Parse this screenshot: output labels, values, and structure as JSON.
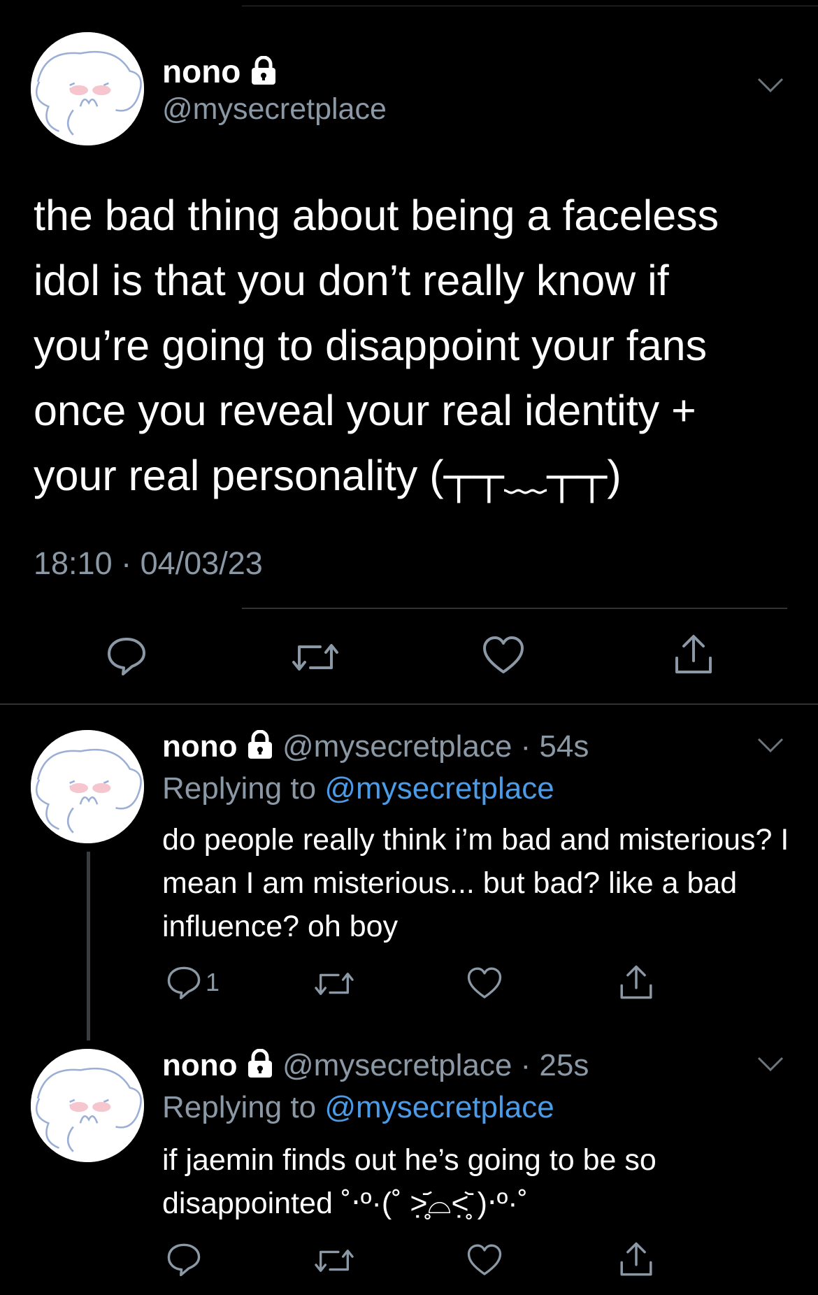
{
  "main_tweet": {
    "display_name": "nono",
    "handle": "@mysecretplace",
    "text": "the bad thing about being a faceless idol is that you don’t really know if you’re going to disappoint your fans once you reveal your real identity + your real personality (┬┬﹏┬┬)",
    "timestamp": "18:10 · 04/03/23",
    "actions": [
      "reply-icon",
      "retweet-icon",
      "like-icon",
      "share-icon"
    ]
  },
  "replies": [
    {
      "display_name": "nono",
      "handle": "@mysecretplace",
      "time": "· 54s",
      "replying_label": "Replying to",
      "replying_to": "@mysecretplace",
      "text": "do people really think i’m bad and misterious? I mean I am misterious... but bad? like a bad influence? oh boy",
      "reply_count": "1"
    },
    {
      "display_name": "nono",
      "handle": "@mysecretplace",
      "time": "· 25s",
      "replying_label": "Replying to",
      "replying_to": "@mysecretplace",
      "text": "if jaemin finds out he’s going to be so disappointed ˚‧º·(˚ ˃̣̣̥᷄⌓˂̣̣̥᷅ )‧º·˚",
      "reply_count": ""
    }
  ],
  "colors": {
    "background": "#000000",
    "secondary_text": "#8b98a5",
    "mention": "#4a9be8",
    "divider": "#2f3336"
  }
}
